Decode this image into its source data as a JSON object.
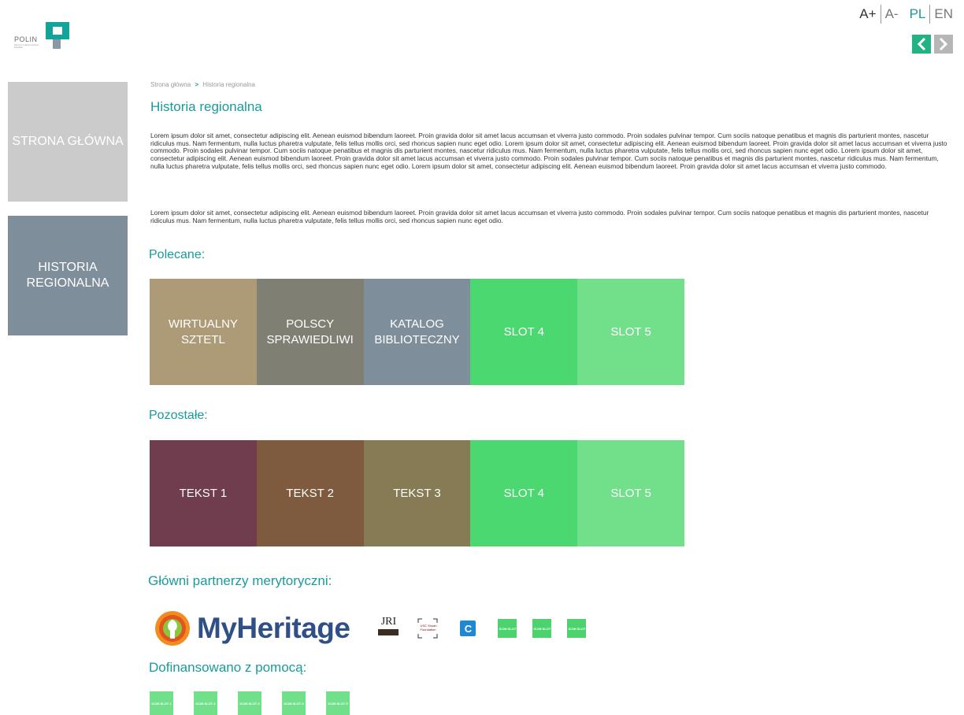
{
  "header": {
    "logo_text": "POLIN",
    "logo_subtext": "Muzeum Historii Żydów Polskich",
    "font_increase": "A+",
    "font_decrease": "A-",
    "lang_pl": "PL",
    "lang_en": "EN",
    "prev_glyph": "<",
    "next_glyph": ">"
  },
  "sidebar": {
    "home_label": "STRONA GŁÓWNA",
    "region_label": "HISTORIA REGIONALNA"
  },
  "breadcrumb": {
    "home": "Strona główna",
    "separator": ">",
    "current": "Historia regionalna"
  },
  "main": {
    "title": "Historia regionalna",
    "paragraph1": "Lorem ipsum dolor sit amet, consectetur adipiscing elit. Aenean euismod bibendum laoreet. Proin gravida dolor sit amet lacus accumsan et viverra justo commodo. Proin sodales pulvinar tempor. Cum sociis natoque penatibus et magnis dis parturient montes, nascetur ridiculus mus. Nam fermentum, nulla luctus pharetra vulputate, felis tellus mollis orci, sed rhoncus sapien nunc eget odio. Lorem ipsum dolor sit amet, consectetur adipiscing elit. Aenean euismod bibendum laoreet. Proin gravida dolor sit amet lacus accumsan et viverra justo commodo. Proin sodales pulvinar tempor. Cum sociis natoque penatibus et magnis dis parturient montes, nascetur ridiculus mus. Nam fermentum, nulla luctus pharetra vulputate, felis tellus mollis orci, sed rhoncus sapien nunc eget odio. Lorem ipsum dolor sit amet, consectetur adipiscing elit. Aenean euismod bibendum laoreet. Proin gravida dolor sit amet lacus accumsan et viverra justo commodo. Proin sodales pulvinar tempor. Cum sociis natoque penatibus et magnis dis parturient montes, nascetur ridiculus mus. Nam fermentum, nulla luctus pharetra vulputate, felis tellus mollis orci, sed rhoncus sapien nunc eget odio. Lorem ipsum dolor sit amet, consectetur adipiscing elit. Aenean euismod bibendum laoreet. Proin gravida dolor sit amet lacus accumsan et viverra justo commodo.",
    "paragraph2": "Lorem ipsum dolor sit amet, consectetur adipiscing elit. Aenean euismod bibendum laoreet. Proin gravida dolor sit amet lacus accumsan et viverra justo commodo. Proin sodales pulvinar tempor. Cum sociis natoque penatibus et magnis dis parturient montes, nascetur ridiculus mus. Nam fermentum, nulla luctus pharetra vulputate, felis tellus mollis orci, sed rhoncus sapien nunc eget odio."
  },
  "recommended": {
    "heading": "Polecane:",
    "tiles": [
      {
        "label": "WIRTUALNY SZTETL",
        "color": "#ad9b77"
      },
      {
        "label": "POLSCY SPRAWIEDLIWI",
        "color": "#807f73"
      },
      {
        "label": "KATALOG BIBLIOTECZNY",
        "color": "#7f8e9b"
      },
      {
        "label": "SLOT 4",
        "color": "#4cd870"
      },
      {
        "label": "SLOT 5",
        "color": "#72e08a"
      }
    ]
  },
  "other": {
    "heading": "Pozostałe:",
    "tiles": [
      {
        "label": "TEKST 1",
        "color": "#6f3d4d"
      },
      {
        "label": "TEKST 2",
        "color": "#7e5b3e"
      },
      {
        "label": "TEKST 3",
        "color": "#867b55"
      },
      {
        "label": "SLOT 4",
        "color": "#4cd870"
      },
      {
        "label": "SLOT 5",
        "color": "#72e08a"
      }
    ]
  },
  "partners": {
    "heading": "Główni partnerzy merytoryczni:",
    "myheritage": "MyHeritage",
    "jri": "JRI",
    "usc": "USC Shoah Foundation",
    "c_letter": "C",
    "icon_slot": "ICON SLOT"
  },
  "funding": {
    "heading": "Dofinansowano z pomocą:",
    "slots": [
      "ICON SLOT 1",
      "ICON SLOT 2",
      "ICON SLOT 3",
      "ICON SLOT 4",
      "ICON SLOT 5"
    ]
  },
  "colors": {
    "accent": "#1a9b9b",
    "arrow_active": "#23b283",
    "arrow_inactive": "#b6b6b6"
  }
}
